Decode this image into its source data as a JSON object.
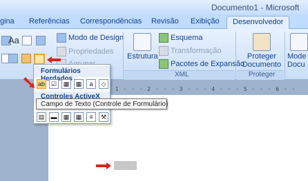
{
  "window": {
    "title": "Documento1 - Microsoft"
  },
  "tabs": [
    {
      "label": "gina"
    },
    {
      "label": "Referências"
    },
    {
      "label": "Correspondências"
    },
    {
      "label": "Revisão"
    },
    {
      "label": "Exibição"
    },
    {
      "label": "Desenvolvedor"
    }
  ],
  "ribbon": {
    "controls_group": {
      "modo_design": "Modo de Design",
      "propriedades": "Propriedades",
      "agrupar": "Agrupar"
    },
    "xml_group": {
      "estrutura": "Estrutura",
      "esquema": "Esquema",
      "transformacao": "Transformação",
      "pacotes": "Pacotes de Expansão",
      "label": "XML"
    },
    "protect_group": {
      "proteger_doc_line1": "Proteger",
      "proteger_doc_line2": "Documento",
      "label": "Proteger"
    },
    "modo_cut": "Mode",
    "modo_cut2": "Docu"
  },
  "dropdown": {
    "heading_legacy": "Formulários Herdados",
    "heading_activex": "Controles ActiveX",
    "legacy_icons": [
      "ab",
      "☑",
      "▦",
      "▦",
      "a",
      "◇"
    ],
    "activex_icons": [
      "▤",
      "▬",
      "▦",
      "▦",
      "≡",
      "⚒"
    ]
  },
  "tooltip": {
    "text": "Campo de Texto (Controle de Formulário)"
  },
  "ruler": {
    "text": "· 1 · · · 2 · · · 3 · · · 4 · · · 5 · · · 6 · ·"
  },
  "colors": {
    "arrow": "#e0201b",
    "accent": "#15428b"
  }
}
